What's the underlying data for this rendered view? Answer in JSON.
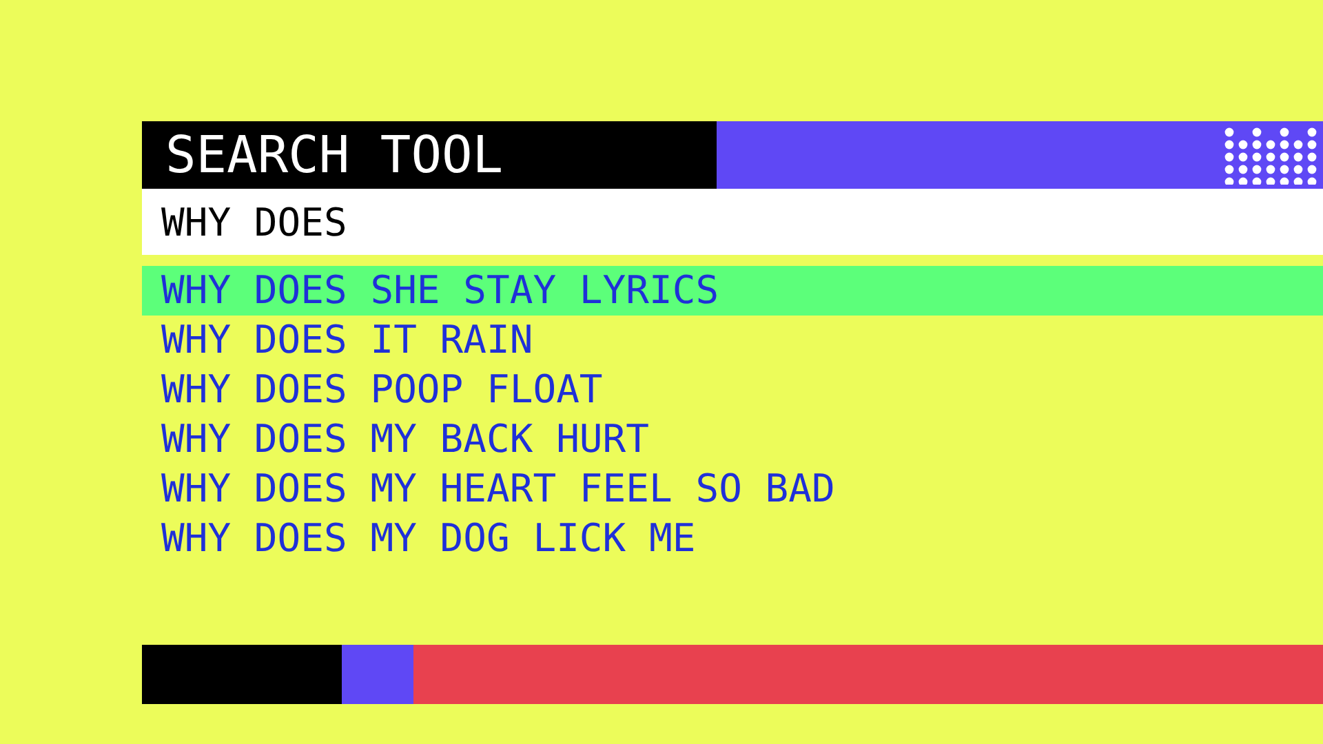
{
  "title": "SEARCH TOOL",
  "search": {
    "value": "WHY DOES"
  },
  "suggestions": [
    {
      "label": "WHY DOES SHE STAY LYRICS",
      "selected": true
    },
    {
      "label": "WHY DOES IT RAIN",
      "selected": false
    },
    {
      "label": "WHY DOES POOP FLOAT",
      "selected": false
    },
    {
      "label": "WHY DOES MY BACK HURT",
      "selected": false
    },
    {
      "label": "WHY DOES MY HEART FEEL SO BAD",
      "selected": false
    },
    {
      "label": "WHY DOES MY DOG LICK ME",
      "selected": false
    }
  ]
}
